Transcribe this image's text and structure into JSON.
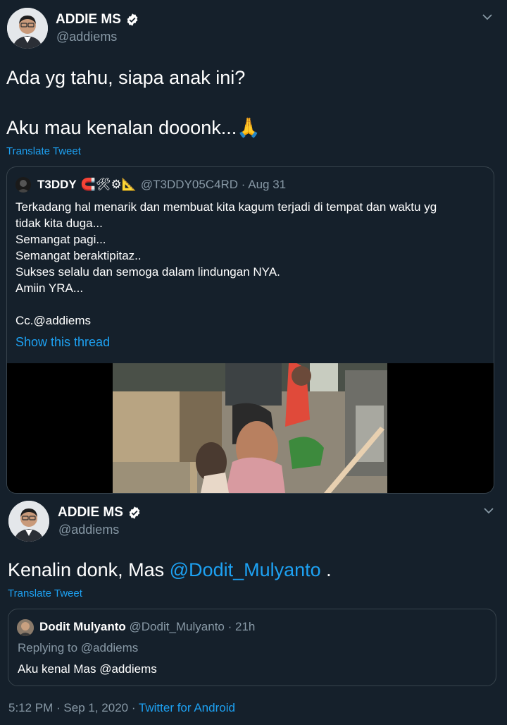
{
  "tweet1": {
    "name": "ADDIE MS",
    "handle": "@addiems",
    "line1": "Ada yg tahu, siapa anak ini?",
    "line2": "Aku mau kenalan dooonk...",
    "emoji": "🙏",
    "translate": "Translate Tweet"
  },
  "quote1": {
    "name": "T3DDY",
    "emojis": "🧲🛠⚙📐",
    "meta": "@T3DDY05C4RD · Aug 31",
    "lines": [
      "Terkadang hal menarik dan membuat kita kagum terjadi di tempat dan waktu yg",
      "tidak kita duga...",
      "Semangat pagi...",
      "Semangat beraktipitaz..",
      "Sukses selalu dan semoga dalam lindungan NYA.",
      "Amiin YRA..."
    ],
    "cc": "Cc.@addiems",
    "show_thread": "Show this thread"
  },
  "tweet2": {
    "name": "ADDIE MS",
    "handle": "@addiems",
    "text_prefix": "Kenalin donk, Mas ",
    "mention": "@Dodit_Mulyanto",
    "text_suffix": " .",
    "translate": "Translate Tweet"
  },
  "quote2": {
    "name": "Dodit Mulyanto",
    "meta": "@Dodit_Mulyanto · 21h",
    "replying": "Replying to @addiems",
    "text": "Aku kenal Mas @addiems"
  },
  "footer": {
    "timestamp": "5:12 PM · Sep 1, 2020 · ",
    "source": "Twitter for Android"
  },
  "colors": {
    "background": "#15202b",
    "accent": "#1da1f2",
    "muted": "#8899a6",
    "border": "#38444d"
  }
}
